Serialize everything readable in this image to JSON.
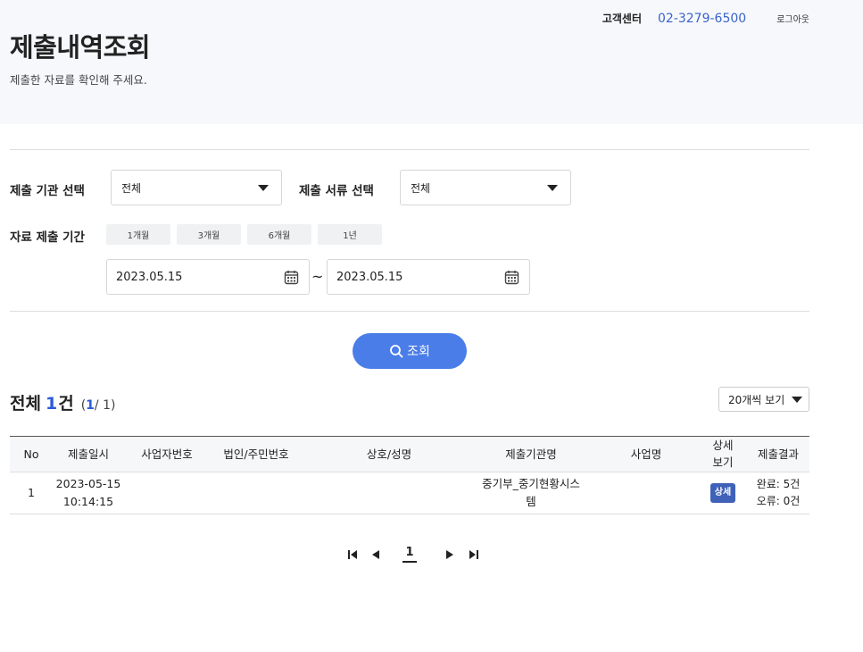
{
  "header": {
    "cs_label": "고객센터",
    "cs_phone": "02-3279-6500",
    "logout": "로그아웃",
    "title": "제출내역조회",
    "subtitle": "제출한 자료를 확인해 주세요."
  },
  "filters": {
    "org_label": "제출 기관 선택",
    "org_value": "전체",
    "doc_label": "제출 서류 선택",
    "doc_value": "전체",
    "period_label": "자료 제출 기간",
    "period_buttons": [
      "1개월",
      "3개월",
      "6개월",
      "1년"
    ],
    "start_date": "2023.05.15",
    "date_sep": "~",
    "end_date": "2023.05.15",
    "search_label": "조회"
  },
  "summary": {
    "total_label": "전체",
    "total_count": "1",
    "total_unit": "건",
    "page_open": "(",
    "page_current": "1",
    "page_rest": "/ 1)",
    "per_page": "20개씩 보기"
  },
  "table": {
    "headers": {
      "no": "No",
      "date": "제출일시",
      "biz_no": "사업자번호",
      "corp_no": "법인/주민번호",
      "name": "상호/성명",
      "org": "제출기관명",
      "biz_name": "사업명",
      "detail": "상세\n보기",
      "result": "제출결과"
    },
    "rows": [
      {
        "no": "1",
        "date": "2023-05-15\n10:14:15",
        "biz_no": "",
        "corp_no": "",
        "name": "",
        "org": "중기부_중기현황시스\n템",
        "biz_name": "",
        "detail": "상세",
        "result": "완료: 5건\n오류: 0건"
      }
    ]
  },
  "pagination": {
    "current": "1"
  },
  "colors": {
    "accent": "#4a7de8",
    "link": "#3a64c8",
    "detail_button": "#3f62b8"
  }
}
